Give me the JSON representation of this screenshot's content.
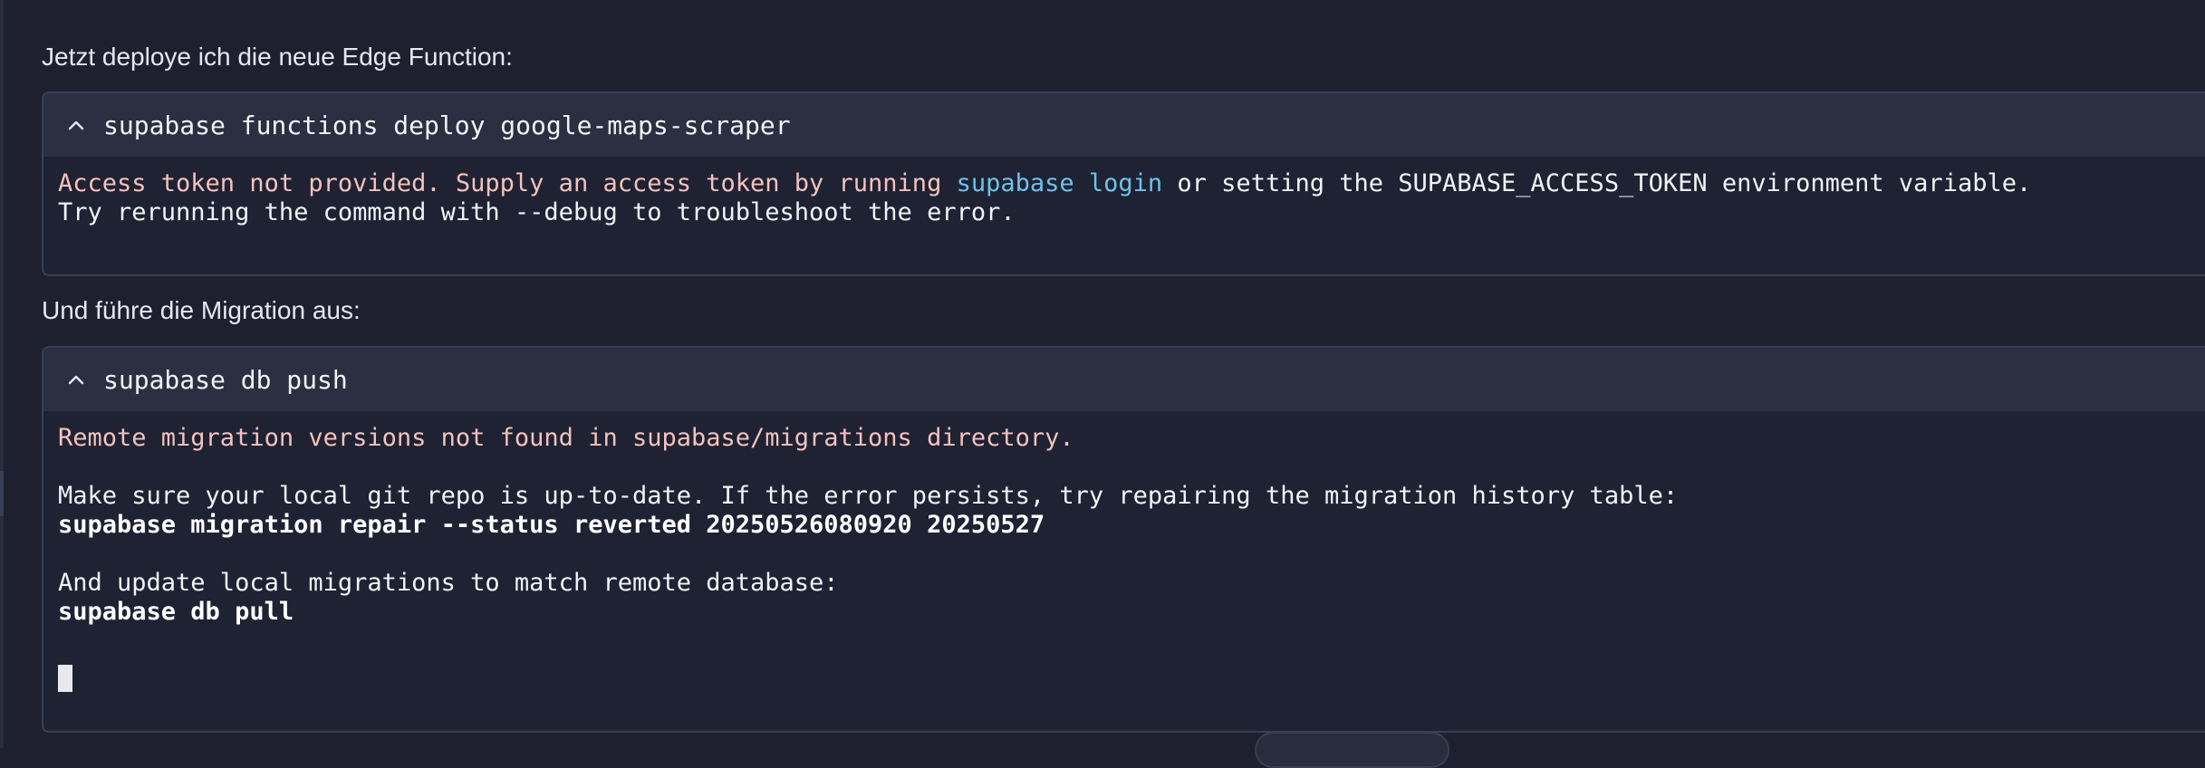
{
  "narration": {
    "deploy_intro": "Jetzt deploye ich die neue Edge Function:",
    "migration_intro": "Und führe die Migration aus:"
  },
  "blocks": [
    {
      "command": "supabase functions deploy google-maps-scraper",
      "collapse_icon": "chevron-up-icon",
      "output": {
        "line1_pre": "Access token not provided. Supply an access token by running ",
        "line1_link": "supabase login",
        "line1_post": " or setting the SUPABASE_ACCESS_TOKEN environment variable.",
        "line2": "Try rerunning the command with --debug to troubleshoot the error."
      }
    },
    {
      "command": "supabase db push",
      "collapse_icon": "chevron-up-icon",
      "output": {
        "error": "Remote migration versions not found in supabase/migrations directory.",
        "hint1": "Make sure your local git repo is up-to-date. If the error persists, try repairing the migration history table:",
        "cmd1": "supabase migration repair --status reverted 20250526080920 20250527",
        "hint2": "And update local migrations to match remote database:",
        "cmd2": "supabase db pull"
      }
    }
  ],
  "colors": {
    "background": "#1e2030",
    "header": "#2c2f42",
    "error_text": "#f3c3bc",
    "link_text": "#6ec2e8"
  }
}
